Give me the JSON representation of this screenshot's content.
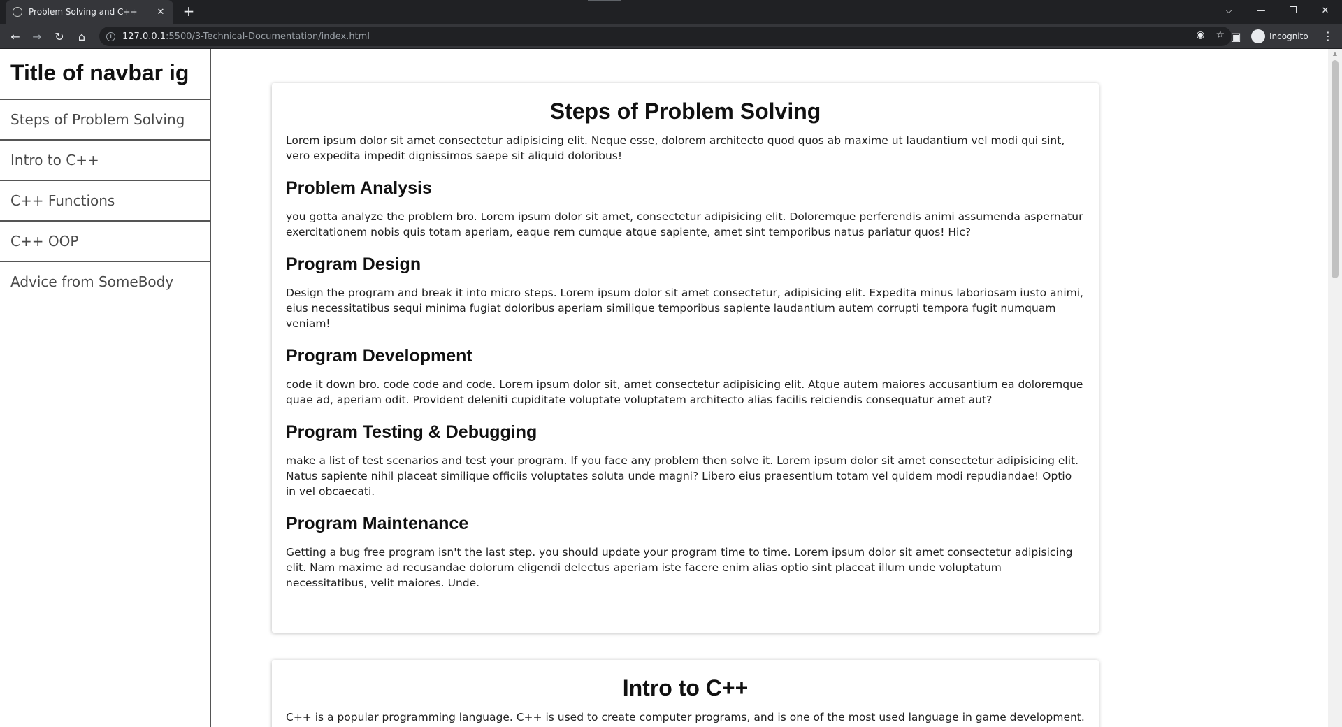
{
  "browser": {
    "tab_title": "Problem Solving and C++",
    "tab_close": "✕",
    "new_tab": "+",
    "url_host": "127.0.0.1",
    "url_path": ":5500/3-Technical-Documentation/index.html",
    "profile_label": "Incognito"
  },
  "navbar": {
    "title": "Title of navbar ig",
    "links": [
      "Steps of Problem Solving",
      "Intro to C++",
      "C++ Functions",
      "C++ OOP",
      "Advice from SomeBody"
    ]
  },
  "sections": [
    {
      "title": "Steps of Problem Solving",
      "intro": "Lorem ipsum dolor sit amet consectetur adipisicing elit. Neque esse, dolorem architecto quod quos ab maxime ut laudantium vel modi qui sint, vero expedita impedit dignissimos saepe sit aliquid doloribus!",
      "subsections": [
        {
          "heading": "Problem Analysis",
          "text": "you gotta analyze the problem bro. Lorem ipsum dolor sit amet, consectetur adipisicing elit. Doloremque perferendis animi assumenda aspernatur exercitationem nobis quis totam aperiam, eaque rem cumque atque sapiente, amet sint temporibus natus pariatur quos! Hic?"
        },
        {
          "heading": "Program Design",
          "text": "Design the program and break it into micro steps. Lorem ipsum dolor sit amet consectetur, adipisicing elit. Expedita minus laboriosam iusto animi, eius necessitatibus sequi minima fugiat doloribus aperiam similique temporibus sapiente laudantium autem corrupti tempora fugit numquam veniam!"
        },
        {
          "heading": "Program Development",
          "text": "code it down bro. code code and code. Lorem ipsum dolor sit, amet consectetur adipisicing elit. Atque autem maiores accusantium ea doloremque quae ad, aperiam odit. Provident deleniti cupiditate voluptate voluptatem architecto alias facilis reiciendis consequatur amet aut?"
        },
        {
          "heading": "Program Testing & Debugging",
          "text": "make a list of test scenarios and test your program. If you face any problem then solve it. Lorem ipsum dolor sit amet consectetur adipisicing elit. Natus sapiente nihil placeat similique officiis voluptates soluta unde magni? Libero eius praesentium totam vel quidem modi repudiandae! Optio in vel obcaecati."
        },
        {
          "heading": "Program Maintenance",
          "text": "Getting a bug free program isn't the last step. you should update your program time to time. Lorem ipsum dolor sit amet consectetur adipisicing elit. Nam maxime ad recusandae dolorum eligendi delectus aperiam iste facere enim alias optio sint placeat illum unde voluptatum necessitatibus, velit maiores. Unde."
        }
      ]
    },
    {
      "title": "Intro to C++",
      "intro": "C++ is a popular programming language. C++ is used to create computer programs, and is one of the most used language in game development."
    }
  ]
}
